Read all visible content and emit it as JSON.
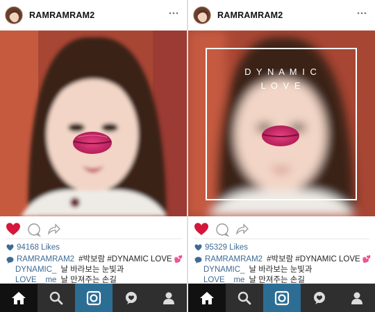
{
  "panels": [
    {
      "username": "RAMRAMRAM2",
      "likes": "94168 Likes",
      "caption_user": "RAMRAMRAM2",
      "caption_text": "#박보람 #DYNAMIC LOVE",
      "lines": [
        {
          "user": "DYNAMIC_",
          "text": "날 바라보는 눈빛과"
        },
        {
          "user": "LOVE__me",
          "text": "날 만져주는 손길"
        }
      ],
      "overlay": null
    },
    {
      "username": "RAMRAMRAM2",
      "likes": "95329 Likes",
      "caption_user": "RAMRAMRAM2",
      "caption_text": "#박보람 #DYNAMIC LOVE",
      "lines": [
        {
          "user": "DYNAMIC_",
          "text": "날 바라보는 눈빛과"
        },
        {
          "user": "LOVE__me",
          "text": "날 만져주는 손길"
        }
      ],
      "overlay": {
        "line1": "D Y N A M I C",
        "line2": "L O V E"
      }
    }
  ],
  "emoji": "💕",
  "icons": {
    "more": "more-dots-icon",
    "like": "heart-filled-icon",
    "comment": "comment-bubble-icon",
    "share": "share-arrow-icon",
    "likes_prefix": "heart-small-icon",
    "caption_prefix": "speech-bubble-icon",
    "nav": [
      "home-icon",
      "search-icon",
      "camera-icon",
      "activity-icon",
      "profile-icon"
    ]
  },
  "colors": {
    "link": "#3e6a94",
    "like_red": "#d4173b",
    "nav_bg": "#2f2f2f",
    "nav_active": "#111111",
    "nav_camera": "#2c6d94"
  }
}
